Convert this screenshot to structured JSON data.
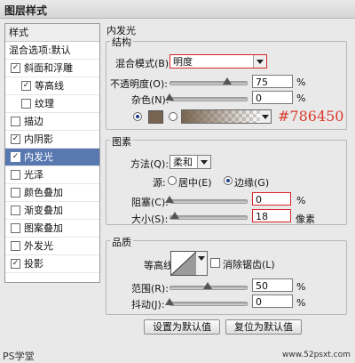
{
  "window": {
    "title": "图层样式"
  },
  "sidebar": {
    "header": "样式",
    "items": [
      {
        "label": "混合选项:默认",
        "checkbox": false,
        "checked": false,
        "indent": false,
        "selected": false
      },
      {
        "label": "斜面和浮雕",
        "checkbox": true,
        "checked": true,
        "indent": false,
        "selected": false
      },
      {
        "label": "等高线",
        "checkbox": true,
        "checked": true,
        "indent": true,
        "selected": false
      },
      {
        "label": "纹理",
        "checkbox": true,
        "checked": false,
        "indent": true,
        "selected": false
      },
      {
        "label": "描边",
        "checkbox": true,
        "checked": false,
        "indent": false,
        "selected": false
      },
      {
        "label": "内阴影",
        "checkbox": true,
        "checked": true,
        "indent": false,
        "selected": false
      },
      {
        "label": "内发光",
        "checkbox": true,
        "checked": true,
        "indent": false,
        "selected": true
      },
      {
        "label": "光泽",
        "checkbox": true,
        "checked": false,
        "indent": false,
        "selected": false
      },
      {
        "label": "颜色叠加",
        "checkbox": true,
        "checked": false,
        "indent": false,
        "selected": false
      },
      {
        "label": "渐变叠加",
        "checkbox": true,
        "checked": false,
        "indent": false,
        "selected": false
      },
      {
        "label": "图案叠加",
        "checkbox": true,
        "checked": false,
        "indent": false,
        "selected": false
      },
      {
        "label": "外发光",
        "checkbox": true,
        "checked": false,
        "indent": false,
        "selected": false
      },
      {
        "label": "投影",
        "checkbox": true,
        "checked": true,
        "indent": false,
        "selected": false
      }
    ]
  },
  "panel": {
    "title": "内发光",
    "structure": {
      "label": "结构",
      "blend_mode_label": "混合模式(B):",
      "blend_mode_value": "明度",
      "opacity_label": "不透明度(O):",
      "opacity_value": "75",
      "opacity_pct": 0.75,
      "noise_label": "杂色(N):",
      "noise_value": "0",
      "noise_pct": 0.0,
      "percent": "%",
      "color_hex_note": "#786450",
      "glow_color": "#786450"
    },
    "elements": {
      "label": "图素",
      "method_label": "方法(Q):",
      "method_value": "柔和",
      "source_label": "源:",
      "source_center": "居中(E)",
      "source_edge": "边缘(G)",
      "choke_label": "阻塞(C):",
      "choke_value": "0",
      "choke_pct": 0.0,
      "size_label": "大小(S):",
      "size_value": "18",
      "size_pct": 0.07,
      "size_unit": "像素",
      "percent": "%"
    },
    "quality": {
      "label": "品质",
      "contour_label": "等高线:",
      "antialias_label": "消除锯齿(L)",
      "range_label": "范围(R):",
      "range_value": "50",
      "range_pct": 0.5,
      "jitter_label": "抖动(J):",
      "jitter_value": "0",
      "jitter_pct": 0.0,
      "percent": "%"
    },
    "buttons": {
      "set_default": "设置为默认值",
      "reset_default": "复位为默认值"
    }
  },
  "watermark": {
    "left": "PS学堂",
    "right": "www.52psxt.com"
  }
}
